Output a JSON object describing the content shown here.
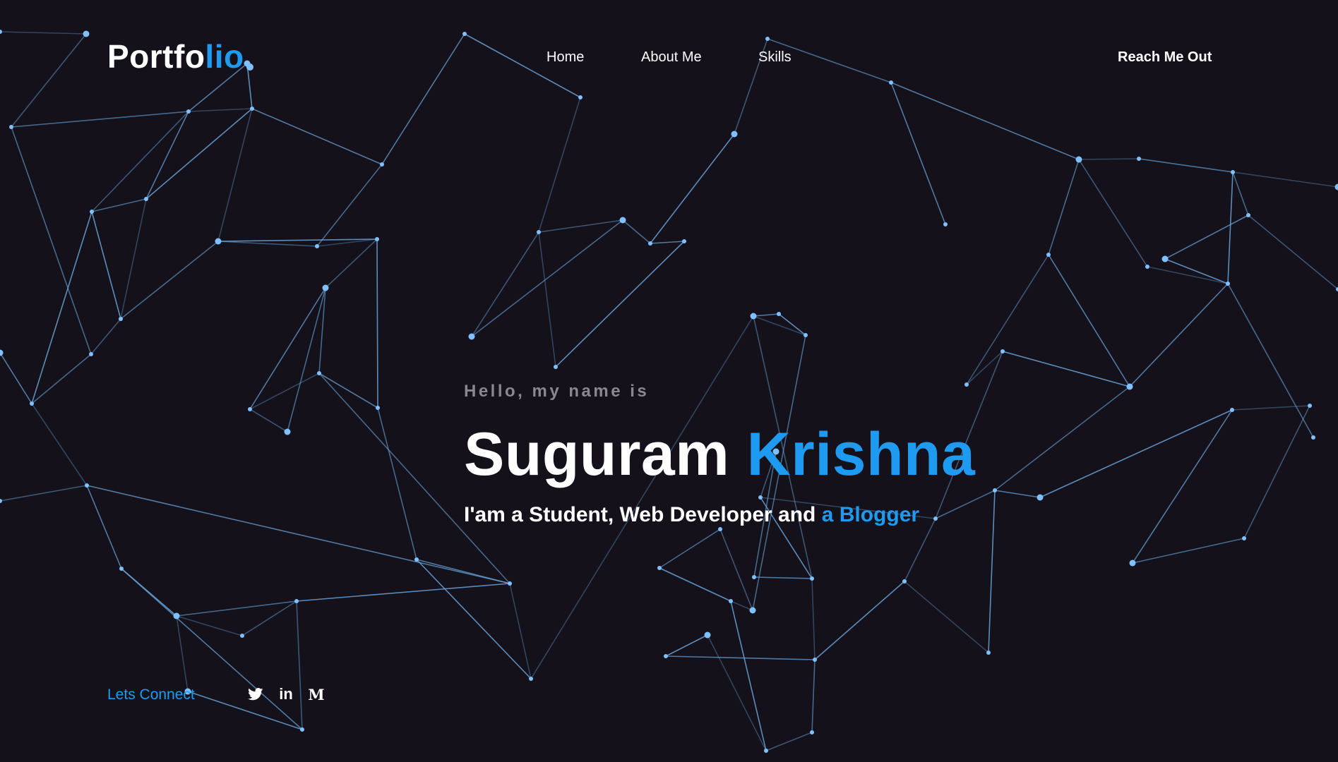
{
  "brand": {
    "logo_main": "Portfo",
    "logo_accent": "lio"
  },
  "nav": {
    "items": [
      {
        "label": "Home"
      },
      {
        "label": "About Me"
      },
      {
        "label": "Skills"
      }
    ],
    "cta_label": "Reach Me Out"
  },
  "hero": {
    "greeting": "Hello, my name is",
    "first_name": "Suguram",
    "last_name": "Krishna",
    "tagline_prefix": "I'am a Student, Web Developer and ",
    "tagline_accent": "a Blogger"
  },
  "footer": {
    "connect_label": "Lets Connect",
    "social_icons": [
      "twitter-icon",
      "linkedin-icon",
      "medium-icon"
    ],
    "linkedin_glyph": "in",
    "medium_glyph": "M"
  },
  "colors": {
    "background": "#14111b",
    "accent": "#1e9bf0",
    "network_line": "#6aa6dc",
    "network_node": "#7fc1ff",
    "muted_text": "#8a8792"
  }
}
